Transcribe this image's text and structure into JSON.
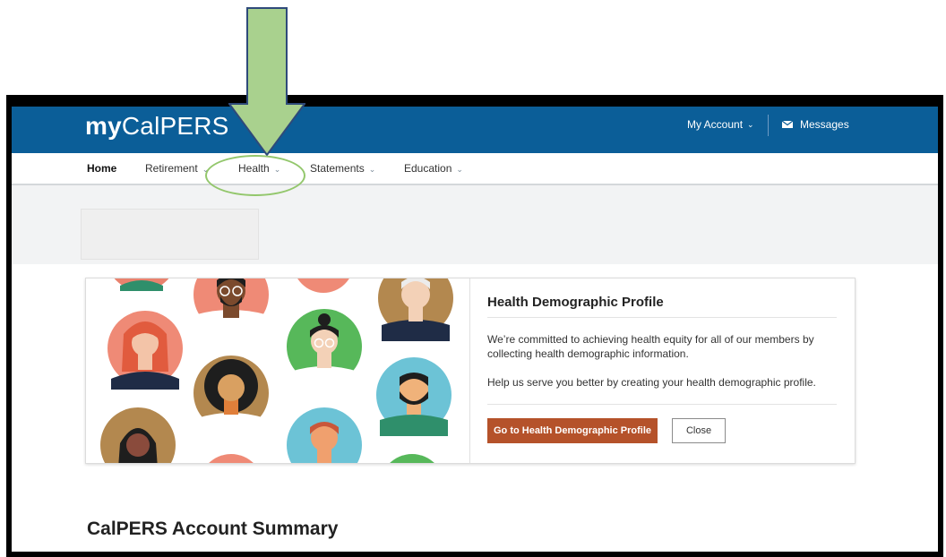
{
  "app": {
    "logo_my": "my",
    "logo_rest": "CalPERS",
    "brand_color": "#0b5e98"
  },
  "header": {
    "account_label": "My Account",
    "messages_label": "Messages",
    "messages_icon": "envelope-icon"
  },
  "nav": {
    "items": [
      {
        "label": "Home",
        "active": true
      },
      {
        "label": "Retirement",
        "has_dropdown": true
      },
      {
        "label": "Health",
        "has_dropdown": true
      },
      {
        "label": "Statements",
        "has_dropdown": true
      },
      {
        "label": "Education",
        "has_dropdown": true
      }
    ]
  },
  "card": {
    "title": "Health Demographic Profile",
    "paragraph1": "We’re committed to achieving health equity for all of our members by collecting health demographic information.",
    "paragraph2": "Help us serve you better by creating your health demographic profile.",
    "primary_button": "Go to Health Demographic Profile",
    "close_button": "Close",
    "primary_color": "#b5522a"
  },
  "main": {
    "summary_title": "CalPERS Account Summary"
  },
  "annotation": {
    "arrow_color": "#a9d18e",
    "highlight_color": "#93c76c"
  }
}
